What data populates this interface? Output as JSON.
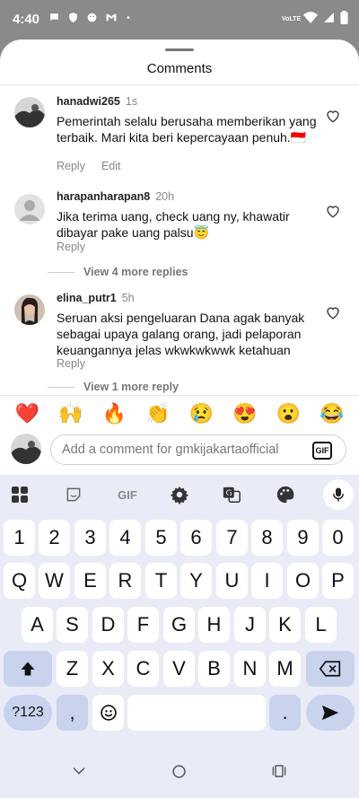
{
  "status": {
    "time": "4:40",
    "network": "VoLTE"
  },
  "sheet": {
    "title": "Comments"
  },
  "comments": [
    {
      "username": "hanadwi265",
      "time": "1s",
      "text": "Pemerintah selalu berusaha memberikan yang terbaik. Mari kita beri kepercayaan penuh.🇮🇩",
      "reply": "Reply",
      "edit": "Edit"
    },
    {
      "username": "harapanharapan8",
      "time": "20h",
      "text": "Jika terima uang, check uang ny, khawatir dibayar pake uang palsu😇",
      "reply": "Reply",
      "more": "View 4 more replies"
    },
    {
      "username": "elina_putr1",
      "time": "5h",
      "text": "Seruan aksi pengeluaran Dana agak banyak sebagai upaya galang orang, jadi pelaporan keuangannya jelas wkwkwkwwk ketahuan",
      "reply": "Reply",
      "more": "View 1 more reply"
    }
  ],
  "emojis": [
    "❤️",
    "🙌",
    "🔥",
    "👏",
    "😢",
    "😍",
    "😮",
    "😂"
  ],
  "composer": {
    "placeholder": "Add a comment for gmkijakartaofficial",
    "gif": "GIF"
  },
  "keyboard": {
    "toolbar_gif": "GIF",
    "row_numbers": [
      "1",
      "2",
      "3",
      "4",
      "5",
      "6",
      "7",
      "8",
      "9",
      "0"
    ],
    "row_q": [
      "Q",
      "W",
      "E",
      "R",
      "T",
      "Y",
      "U",
      "I",
      "O",
      "P"
    ],
    "row_a": [
      "A",
      "S",
      "D",
      "F",
      "G",
      "H",
      "J",
      "K",
      "L"
    ],
    "row_z": [
      "Z",
      "X",
      "C",
      "V",
      "B",
      "N",
      "M"
    ],
    "symbols": "?123",
    "comma": ",",
    "period": "."
  }
}
